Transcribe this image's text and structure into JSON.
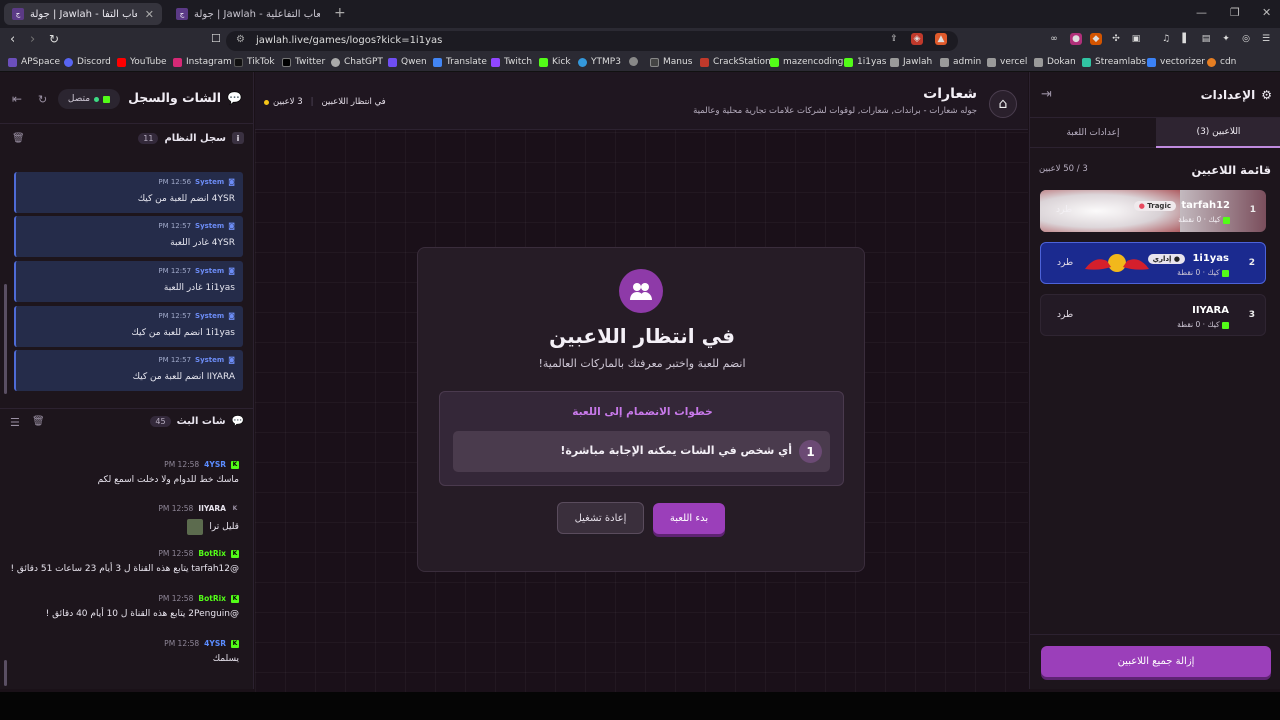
{
  "browser": {
    "tabs": [
      {
        "title": "جولة | Jawlah - منصة الألعاب التفا",
        "active": true
      },
      {
        "title": "جولة | Jawlah - منصة الألعاب التفاعلية",
        "active": false
      }
    ],
    "url": "jawlah.live/games/logos?kick=1i1yas",
    "bookmarks": [
      "APSpace",
      "Discord",
      "YouTube",
      "Instagram",
      "TikTok",
      "Twitter",
      "ChatGPT",
      "Qwen",
      "Translate",
      "Twitch",
      "Kick",
      "YTMP3",
      "Manus",
      "CrackStation",
      "mazencoding",
      "1i1yas",
      "Jawlah",
      "admin",
      "vercel",
      "Dokan",
      "Streamlabs",
      "vectorizer",
      "cdn"
    ]
  },
  "left": {
    "title": "الشات والسجل",
    "status": "متصل",
    "system_log": {
      "title": "سجل النظام",
      "count": "11",
      "index": "i"
    },
    "system_messages": [
      {
        "sender": "System",
        "time": "PM 12:56",
        "text": "4YSR انضم للعبة من كيك"
      },
      {
        "sender": "System",
        "time": "PM 12:57",
        "text": "4YSR غادر اللعبة"
      },
      {
        "sender": "System",
        "time": "PM 12:57",
        "text": "1i1yas غادر اللعبة"
      },
      {
        "sender": "System",
        "time": "PM 12:57",
        "text": "1i1yas انضم للعبة من كيك"
      },
      {
        "sender": "System",
        "time": "PM 12:57",
        "text": "IIYARA انضم للعبة من كيك"
      }
    ],
    "stream_chat": {
      "title": "شات البث",
      "count": "45"
    },
    "chat_messages": [
      {
        "user": "4YSR",
        "time": "PM 12:58",
        "text": "ماسك خط للدوام ولا دخلت اسمع لكم",
        "color": "#5b8cff"
      },
      {
        "user": "IIYARA",
        "time": "PM 12:58",
        "text": "قليل ترا",
        "color": "#e8e4ee"
      },
      {
        "user": "BotRix",
        "time": "PM 12:58",
        "text": "@tarfah12 يتابع هذه القناة ل 3 أيام 23 ساعات 51 دقائق !",
        "color": "#53fc18"
      },
      {
        "user": "BotRix",
        "time": "PM 12:58",
        "text": "@2Penguin يتابع هذه القناة ل 10 أيام 40 دقائق !",
        "color": "#53fc18"
      },
      {
        "user": "4YSR",
        "time": "PM 12:58",
        "text": "يسلمك",
        "color": "#5b8cff"
      }
    ]
  },
  "center": {
    "game_title": "شعارات",
    "game_subtitle": "جوله شعارات - براندات, شعارات, لوقوات لشركات علامات تجارية محلية وعالمية",
    "status_label": "في انتظار اللاعبين",
    "players_count": "3 لاعبين",
    "modal": {
      "title": "في انتظار اللاعبين",
      "subtitle": "انضم للعبة واختبر معرفتك بالماركات العالمية!",
      "steps_title": "خطوات الانضمام إلى اللعبة",
      "step_number": "1",
      "step_text": "أي شخص في الشات يمكنه الإجابة مباشرة!",
      "start_button": "بدء اللعبة",
      "restart_button": "إعادة تشغيل"
    }
  },
  "right": {
    "title": "الإعدادات",
    "tabs": [
      "اللاعبين (3)",
      "إعدادات اللعبة"
    ],
    "list_title": "قائمة اللاعبين",
    "list_count": "3 / 50 لاعبين",
    "players": [
      {
        "num": "1",
        "name": "tarfah12",
        "badge": "Tragic",
        "sub": "كيك · 0 نقطة",
        "kick": "طرد"
      },
      {
        "num": "2",
        "name": "1i1yas",
        "badge": "إداري",
        "sub": "كيك · 0 نقطة",
        "kick": "طرد"
      },
      {
        "num": "3",
        "name": "IIYARA",
        "badge": "",
        "sub": "كيك · 0 نقطة",
        "kick": "طرد"
      }
    ],
    "remove_all": "إزالة جميع اللاعبين"
  }
}
